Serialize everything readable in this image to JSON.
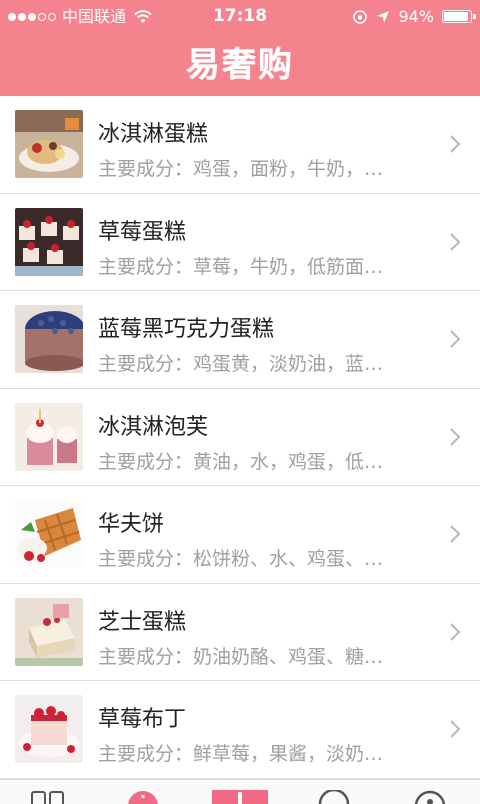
{
  "status_bar": {
    "carrier": "中国联通",
    "time": "17:18",
    "battery": "94%",
    "battery_level": 0.94
  },
  "header": {
    "title": "易奢购"
  },
  "items": [
    {
      "title": "冰淇淋蛋糕",
      "subtitle": "主要成分：鸡蛋，面粉，牛奶，…"
    },
    {
      "title": "草莓蛋糕",
      "subtitle": "主要成分：草莓，牛奶，低筋面…"
    },
    {
      "title": "蓝莓黑巧克力蛋糕",
      "subtitle": "主要成分：鸡蛋黄，淡奶油，蓝…"
    },
    {
      "title": "冰淇淋泡芙",
      "subtitle": "主要成分：黄油，水，鸡蛋，低…"
    },
    {
      "title": "华夫饼",
      "subtitle": "主要成分：松饼粉、水、鸡蛋、…"
    },
    {
      "title": "芝士蛋糕",
      "subtitle": "主要成分：奶油奶酪、鸡蛋、糖…"
    },
    {
      "title": "草莓布丁",
      "subtitle": "主要成分：鲜草莓，果酱，淡奶…"
    }
  ],
  "colors": {
    "header": "#f4838e",
    "tab_active": "#f06a84"
  },
  "tabbar": {
    "icons": [
      "grid-icon",
      "info-icon",
      "add-icon",
      "refresh-icon",
      "user-icon"
    ]
  }
}
